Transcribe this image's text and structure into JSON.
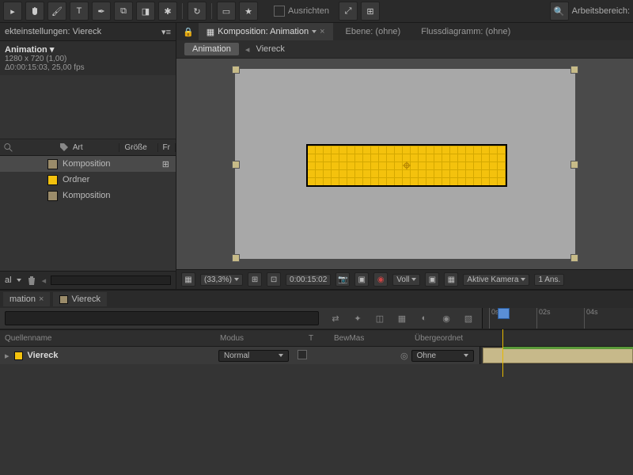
{
  "toolbar": {
    "align_label": "Ausrichten",
    "workspace_label": "Arbeitsbereich:"
  },
  "project": {
    "tab": "ekteinstellungen: Viereck",
    "comp_name": "Animation ▾",
    "resolution": "1280 x 720 (1,00)",
    "duration": "Δ0:00:15:03, 25,00 fps",
    "cols": {
      "art": "Art",
      "size": "Größe",
      "fr": "Fr"
    },
    "rows": [
      {
        "type": "Komposition",
        "color": "tan",
        "selected": true
      },
      {
        "type": "Ordner",
        "color": "yel"
      },
      {
        "type": "Komposition",
        "color": "tan"
      }
    ],
    "footer_label": "al"
  },
  "viewer": {
    "tabs": [
      {
        "label": "Komposition: Animation",
        "active": true
      },
      {
        "label": "Ebene: (ohne)"
      },
      {
        "label": "Flussdiagramm: (ohne)"
      }
    ],
    "breadcrumb": {
      "active": "Animation",
      "next": "Viereck"
    },
    "footer": {
      "zoom": "(33,3%)",
      "time": "0:00:15:02",
      "res": "Voll",
      "camera": "Aktive Kamera",
      "views": "1 Ans."
    }
  },
  "timeline": {
    "tabs": [
      {
        "label": "mation",
        "close": true
      },
      {
        "label": "Viereck",
        "icon": true
      }
    ],
    "ruler": [
      "0s",
      "02s",
      "04s"
    ],
    "cols": {
      "source": "Quellenname",
      "mode": "Modus",
      "t": "T",
      "bewmas": "BewMas",
      "parent": "Übergeordnet"
    },
    "layer": {
      "name": "Viereck",
      "mode": "Normal",
      "parent": "Ohne"
    }
  }
}
